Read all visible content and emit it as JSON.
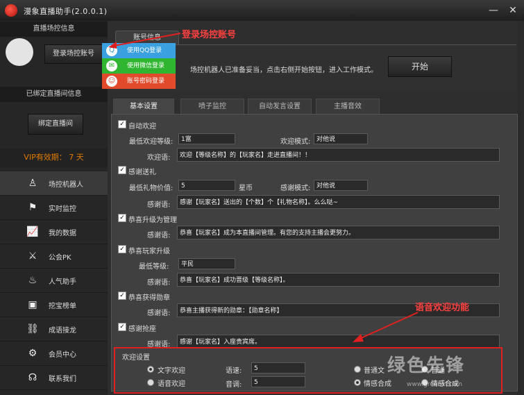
{
  "window": {
    "title": "漫象直播助手(2.0.0.1)"
  },
  "sidebar": {
    "section_host": "直播场控信息",
    "login_button": "登录场控账号",
    "section_room": "已绑定直播间信息",
    "bind_button": "绑定直播间",
    "vip_text": "VIP有效期：  7 天",
    "items": [
      {
        "label": "场控机器人",
        "icon": "robot-icon"
      },
      {
        "label": "实时监控",
        "icon": "monitor-icon"
      },
      {
        "label": "我的数据",
        "icon": "chart-icon"
      },
      {
        "label": "公会PK",
        "icon": "swords-icon"
      },
      {
        "label": "人气助手",
        "icon": "flame-icon"
      },
      {
        "label": "挖宝榜单",
        "icon": "screen-icon"
      },
      {
        "label": "成语接龙",
        "icon": "link-icon"
      },
      {
        "label": "会员中心",
        "icon": "user-gear-icon"
      },
      {
        "label": "联系我们",
        "icon": "headset-icon"
      }
    ]
  },
  "login_menu": {
    "items": [
      {
        "label": "使用QQ登录",
        "color": "#3aa0e0"
      },
      {
        "label": "使用微信登录",
        "color": "#2fb52f"
      },
      {
        "label": "账号密码登录",
        "color": "#e24a2c"
      }
    ]
  },
  "account": {
    "tab_label": "账号信息",
    "status_text": "场控机器人已准备妥当，点击右侧开始按钮，进入工作模式。",
    "start_button": "开始"
  },
  "annotations": {
    "login": "登录场控账号",
    "voice": "语音欢迎功能"
  },
  "tabs": [
    "基本设置",
    "喷子监控",
    "自动发言设置",
    "主播音效"
  ],
  "settings": {
    "welcome": {
      "label": "自动欢迎",
      "level_label": "最低欢迎等级:",
      "level_value": "1富",
      "mode_label": "欢迎模式:",
      "mode_value": "对他说",
      "text_label": "欢迎语:",
      "text_value": "欢迎【等级名称】的【玩家名】走进直播间！！"
    },
    "gift": {
      "label": "感谢送礼",
      "min_label": "最低礼物价值:",
      "min_value": "5",
      "unit": "星币",
      "mode_label": "感谢模式:",
      "mode_value": "对他说",
      "text_label": "感谢语:",
      "text_value": "感谢【玩家名】送出的【个数】个【礼物名称】。么么哒~"
    },
    "admin": {
      "label": "恭喜升级为管理",
      "text_label": "感谢语:",
      "text_value": "恭喜【玩家名】成为本直播间管理。有您的支持主播会更努力。"
    },
    "levelup": {
      "label": "恭喜玩家升级",
      "min_label": "最低等级:",
      "min_value": "平民",
      "text_label": "感谢语:",
      "text_value": "恭喜【玩家名】成功晋级【等级名称】。"
    },
    "medal": {
      "label": "恭喜获得勋章",
      "text_label": "感谢语:",
      "text_value": "恭喜主播获得新的勋章：【勋章名称】"
    },
    "seat": {
      "label": "感谢抢座",
      "text_label": "感谢语:",
      "text_value": "感谢【玩家名】入座贵宾席。"
    },
    "voice": {
      "title": "欢迎设置",
      "text_welcome": "文字欢迎",
      "voice_welcome": "语音欢迎",
      "speed_label": "语速:",
      "speed_value": "5",
      "tone_label": "音调:",
      "tone_value": "5",
      "opt1": "普通文",
      "opt2": "普通",
      "opt3": "情感合成",
      "opt4": "情感合成"
    }
  },
  "watermark": {
    "text": "绿色先锋",
    "url": "www.greenxf.com"
  }
}
